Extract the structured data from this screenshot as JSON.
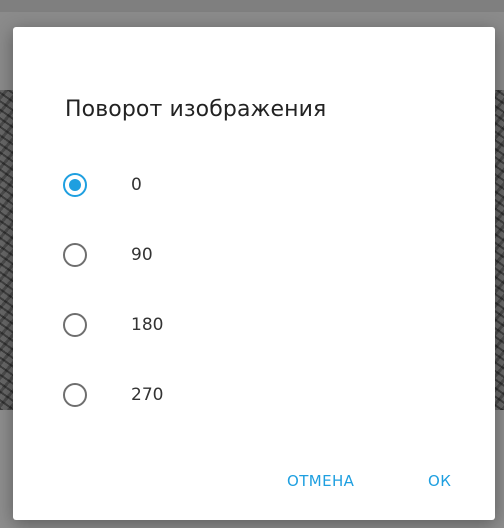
{
  "dialog": {
    "title": "Поворот изображения",
    "options": [
      {
        "label": "0",
        "checked": true
      },
      {
        "label": "90",
        "checked": false
      },
      {
        "label": "180",
        "checked": false
      },
      {
        "label": "270",
        "checked": false
      }
    ],
    "cancel_label": "ОТМЕНА",
    "ok_label": "ОК"
  },
  "colors": {
    "accent": "#1e9fe0",
    "title_text": "#222222",
    "option_text": "#333333",
    "radio_unchecked": "#6e6e6e"
  }
}
